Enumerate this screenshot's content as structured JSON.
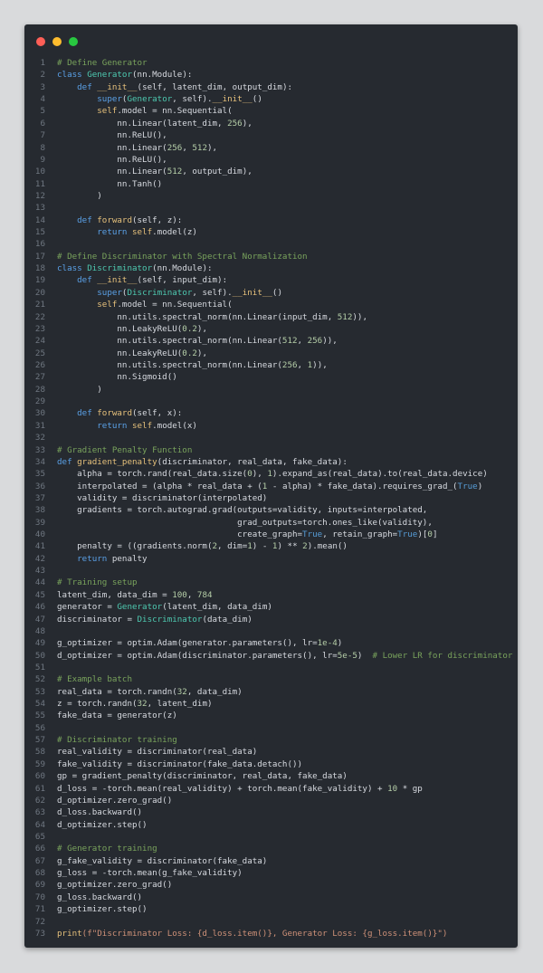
{
  "window": {
    "controls": [
      "close",
      "minimize",
      "maximize"
    ],
    "colors": {
      "close": "#ff5f57",
      "minimize": "#febc2e",
      "maximize": "#28c840",
      "background": "#262a30"
    }
  },
  "code": {
    "language": "python",
    "lines": [
      [
        [
          "# Define Generator",
          "comment"
        ]
      ],
      [
        [
          "class ",
          "kw"
        ],
        [
          "Generator",
          "cls"
        ],
        [
          "(nn.Module):",
          "plain"
        ]
      ],
      [
        [
          "    def ",
          "kw"
        ],
        [
          "__init__",
          "fn"
        ],
        [
          "(self, latent_dim, output_dim):",
          "plain"
        ]
      ],
      [
        [
          "        super",
          "kw"
        ],
        [
          "(",
          "plain"
        ],
        [
          "Generator",
          "cls"
        ],
        [
          ", self).",
          "plain"
        ],
        [
          "__init__",
          "fn"
        ],
        [
          "()",
          "plain"
        ]
      ],
      [
        [
          "        self",
          "self"
        ],
        [
          ".model = nn.Sequential(",
          "plain"
        ]
      ],
      [
        [
          "            nn.Linear(latent_dim, ",
          "plain"
        ],
        [
          "256",
          "num"
        ],
        [
          "),",
          "plain"
        ]
      ],
      [
        [
          "            nn.ReLU(),",
          "plain"
        ]
      ],
      [
        [
          "            nn.Linear(",
          "plain"
        ],
        [
          "256",
          "num"
        ],
        [
          ", ",
          "plain"
        ],
        [
          "512",
          "num"
        ],
        [
          "),",
          "plain"
        ]
      ],
      [
        [
          "            nn.ReLU(),",
          "plain"
        ]
      ],
      [
        [
          "            nn.Linear(",
          "plain"
        ],
        [
          "512",
          "num"
        ],
        [
          ", output_dim),",
          "plain"
        ]
      ],
      [
        [
          "            nn.Tanh()",
          "plain"
        ]
      ],
      [
        [
          "        )",
          "plain"
        ]
      ],
      [
        [
          "",
          "plain"
        ]
      ],
      [
        [
          "    def ",
          "kw"
        ],
        [
          "forward",
          "fn"
        ],
        [
          "(self, z):",
          "plain"
        ]
      ],
      [
        [
          "        return ",
          "kw"
        ],
        [
          "self",
          "self"
        ],
        [
          ".model(z)",
          "plain"
        ]
      ],
      [
        [
          "",
          "plain"
        ]
      ],
      [
        [
          "# Define Discriminator with Spectral Normalization",
          "comment"
        ]
      ],
      [
        [
          "class ",
          "kw"
        ],
        [
          "Discriminator",
          "cls"
        ],
        [
          "(nn.Module):",
          "plain"
        ]
      ],
      [
        [
          "    def ",
          "kw"
        ],
        [
          "__init__",
          "fn"
        ],
        [
          "(self, input_dim):",
          "plain"
        ]
      ],
      [
        [
          "        super",
          "kw"
        ],
        [
          "(",
          "plain"
        ],
        [
          "Discriminator",
          "cls"
        ],
        [
          ", self).",
          "plain"
        ],
        [
          "__init__",
          "fn"
        ],
        [
          "()",
          "plain"
        ]
      ],
      [
        [
          "        self",
          "self"
        ],
        [
          ".model = nn.Sequential(",
          "plain"
        ]
      ],
      [
        [
          "            nn.utils.spectral_norm(nn.Linear(input_dim, ",
          "plain"
        ],
        [
          "512",
          "num"
        ],
        [
          ")),",
          "plain"
        ]
      ],
      [
        [
          "            nn.LeakyReLU(",
          "plain"
        ],
        [
          "0.2",
          "num"
        ],
        [
          "),",
          "plain"
        ]
      ],
      [
        [
          "            nn.utils.spectral_norm(nn.Linear(",
          "plain"
        ],
        [
          "512",
          "num"
        ],
        [
          ", ",
          "plain"
        ],
        [
          "256",
          "num"
        ],
        [
          ")),",
          "plain"
        ]
      ],
      [
        [
          "            nn.LeakyReLU(",
          "plain"
        ],
        [
          "0.2",
          "num"
        ],
        [
          "),",
          "plain"
        ]
      ],
      [
        [
          "            nn.utils.spectral_norm(nn.Linear(",
          "plain"
        ],
        [
          "256",
          "num"
        ],
        [
          ", ",
          "plain"
        ],
        [
          "1",
          "num"
        ],
        [
          ")),",
          "plain"
        ]
      ],
      [
        [
          "            nn.Sigmoid()",
          "plain"
        ]
      ],
      [
        [
          "        )",
          "plain"
        ]
      ],
      [
        [
          "",
          "plain"
        ]
      ],
      [
        [
          "    def ",
          "kw"
        ],
        [
          "forward",
          "fn"
        ],
        [
          "(self, x):",
          "plain"
        ]
      ],
      [
        [
          "        return ",
          "kw"
        ],
        [
          "self",
          "self"
        ],
        [
          ".model(x)",
          "plain"
        ]
      ],
      [
        [
          "",
          "plain"
        ]
      ],
      [
        [
          "# Gradient Penalty Function",
          "comment"
        ]
      ],
      [
        [
          "def ",
          "kw"
        ],
        [
          "gradient_penalty",
          "fn"
        ],
        [
          "(discriminator, real_data, fake_data):",
          "plain"
        ]
      ],
      [
        [
          "    alpha = torch.rand(real_data.size(",
          "plain"
        ],
        [
          "0",
          "num"
        ],
        [
          "), ",
          "plain"
        ],
        [
          "1",
          "num"
        ],
        [
          ").expand_as(real_data).to(real_data.device)",
          "plain"
        ]
      ],
      [
        [
          "    interpolated = (alpha * real_data + (",
          "plain"
        ],
        [
          "1",
          "num"
        ],
        [
          " - alpha) * fake_data).requires_grad_(",
          "plain"
        ],
        [
          "True",
          "const"
        ],
        [
          ")",
          "plain"
        ]
      ],
      [
        [
          "    validity = discriminator(interpolated)",
          "plain"
        ]
      ],
      [
        [
          "    gradients = torch.autograd.grad(outputs=validity, inputs=interpolated,",
          "plain"
        ]
      ],
      [
        [
          "                                    grad_outputs=torch.ones_like(validity),",
          "plain"
        ]
      ],
      [
        [
          "                                    create_graph=",
          "plain"
        ],
        [
          "True",
          "const"
        ],
        [
          ", retain_graph=",
          "plain"
        ],
        [
          "True",
          "const"
        ],
        [
          ")[",
          "plain"
        ],
        [
          "0",
          "num"
        ],
        [
          "]",
          "plain"
        ]
      ],
      [
        [
          "    penalty = ((gradients.norm(",
          "plain"
        ],
        [
          "2",
          "num"
        ],
        [
          ", dim=",
          "plain"
        ],
        [
          "1",
          "num"
        ],
        [
          ") - ",
          "plain"
        ],
        [
          "1",
          "num"
        ],
        [
          ") ** ",
          "plain"
        ],
        [
          "2",
          "num"
        ],
        [
          ").mean()",
          "plain"
        ]
      ],
      [
        [
          "    return ",
          "kw"
        ],
        [
          "penalty",
          "plain"
        ]
      ],
      [
        [
          "",
          "plain"
        ]
      ],
      [
        [
          "# Training setup",
          "comment"
        ]
      ],
      [
        [
          "latent_dim, data_dim = ",
          "plain"
        ],
        [
          "100",
          "num"
        ],
        [
          ", ",
          "plain"
        ],
        [
          "784",
          "num"
        ]
      ],
      [
        [
          "generator = ",
          "plain"
        ],
        [
          "Generator",
          "cls"
        ],
        [
          "(latent_dim, data_dim)",
          "plain"
        ]
      ],
      [
        [
          "discriminator = ",
          "plain"
        ],
        [
          "Discriminator",
          "cls"
        ],
        [
          "(data_dim)",
          "plain"
        ]
      ],
      [
        [
          "",
          "plain"
        ]
      ],
      [
        [
          "g_optimizer = optim.Adam(generator.parameters(), lr=",
          "plain"
        ],
        [
          "1e-4",
          "num"
        ],
        [
          ")",
          "plain"
        ]
      ],
      [
        [
          "d_optimizer = optim.Adam(discriminator.parameters(), lr=",
          "plain"
        ],
        [
          "5e-5",
          "num"
        ],
        [
          ")  ",
          "plain"
        ],
        [
          "# Lower LR for discriminator",
          "comment"
        ]
      ],
      [
        [
          "",
          "plain"
        ]
      ],
      [
        [
          "# Example batch",
          "comment"
        ]
      ],
      [
        [
          "real_data = torch.randn(",
          "plain"
        ],
        [
          "32",
          "num"
        ],
        [
          ", data_dim)",
          "plain"
        ]
      ],
      [
        [
          "z = torch.randn(",
          "plain"
        ],
        [
          "32",
          "num"
        ],
        [
          ", latent_dim)",
          "plain"
        ]
      ],
      [
        [
          "fake_data = generator(z)",
          "plain"
        ]
      ],
      [
        [
          "",
          "plain"
        ]
      ],
      [
        [
          "# Discriminator training",
          "comment"
        ]
      ],
      [
        [
          "real_validity = discriminator(real_data)",
          "plain"
        ]
      ],
      [
        [
          "fake_validity = discriminator(fake_data.detach())",
          "plain"
        ]
      ],
      [
        [
          "gp = gradient_penalty(discriminator, real_data, fake_data)",
          "plain"
        ]
      ],
      [
        [
          "d_loss = -torch.mean(real_validity) + torch.mean(fake_validity) + ",
          "plain"
        ],
        [
          "10",
          "num"
        ],
        [
          " * gp",
          "plain"
        ]
      ],
      [
        [
          "d_optimizer.zero_grad()",
          "plain"
        ]
      ],
      [
        [
          "d_loss.backward()",
          "plain"
        ]
      ],
      [
        [
          "d_optimizer.step()",
          "plain"
        ]
      ],
      [
        [
          "",
          "plain"
        ]
      ],
      [
        [
          "# Generator training",
          "comment"
        ]
      ],
      [
        [
          "g_fake_validity = discriminator(fake_data)",
          "plain"
        ]
      ],
      [
        [
          "g_loss = -torch.mean(g_fake_validity)",
          "plain"
        ]
      ],
      [
        [
          "g_optimizer.zero_grad()",
          "plain"
        ]
      ],
      [
        [
          "g_loss.backward()",
          "plain"
        ]
      ],
      [
        [
          "g_optimizer.step()",
          "plain"
        ]
      ],
      [
        [
          "",
          "plain"
        ]
      ],
      [
        [
          "print",
          "fn"
        ],
        [
          "(f\"Discriminator Loss: {d_loss.item()}, Generator Loss: {g_loss.item()}\")",
          "str"
        ]
      ]
    ]
  }
}
